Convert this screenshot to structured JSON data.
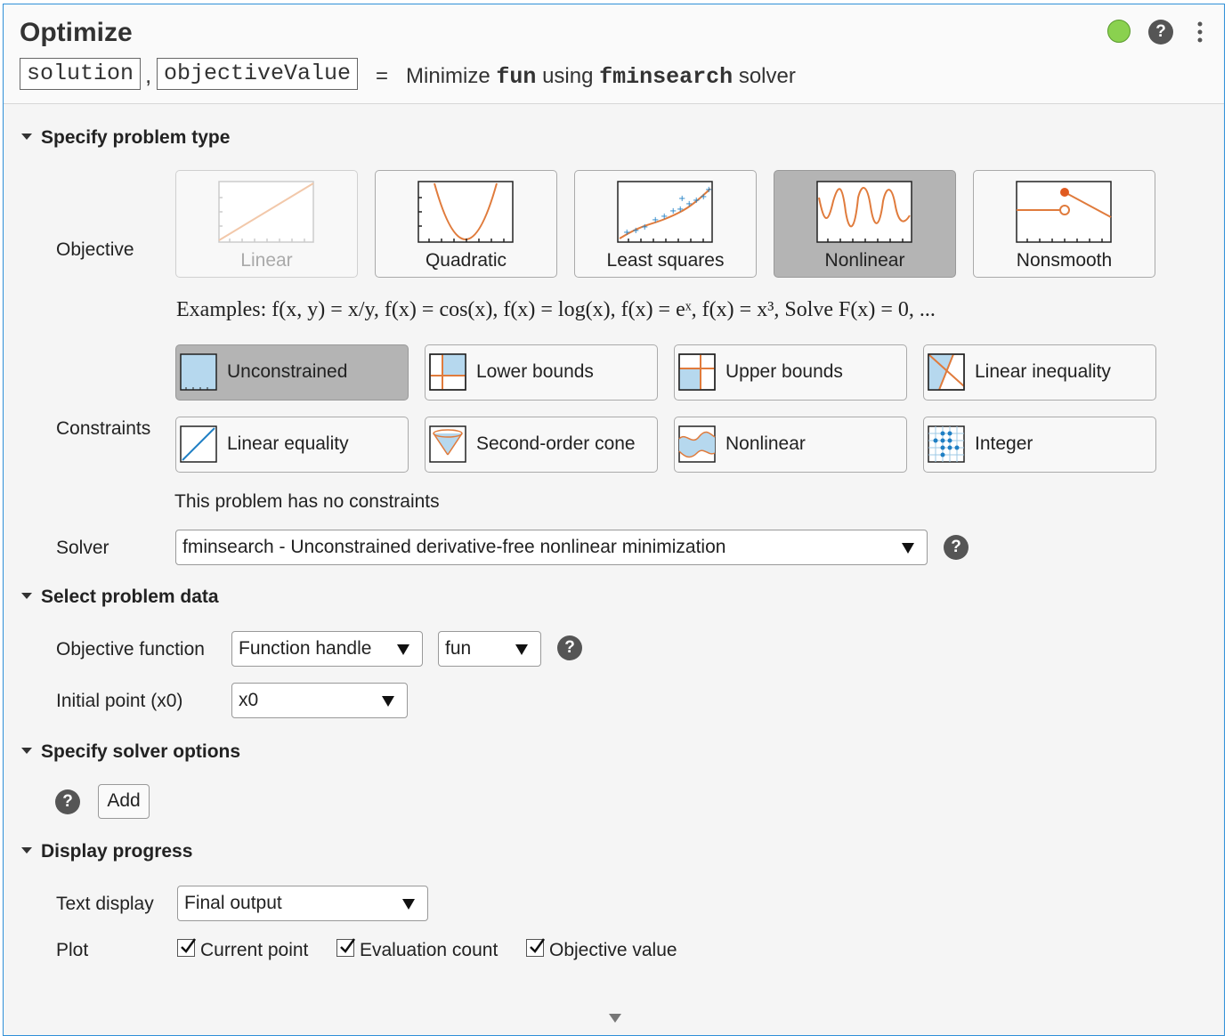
{
  "header": {
    "title": "Optimize",
    "outputs": [
      "solution",
      "objectiveValue"
    ],
    "comma": ",",
    "equals": "=",
    "minimize_text": "Minimize",
    "fun_name": "fun",
    "using_text": "using",
    "solver_name": "fminsearch",
    "solver_suffix": "solver",
    "status_color": "#8ad14f",
    "help_glyph": "?"
  },
  "problem_type": {
    "section_title": "Specify problem type",
    "objective_label": "Objective",
    "objectives": [
      {
        "label": "Linear",
        "icon": "linear-plot-icon",
        "state": "disabled"
      },
      {
        "label": "Quadratic",
        "icon": "quadratic-plot-icon",
        "state": "normal"
      },
      {
        "label": "Least squares",
        "icon": "least-squares-plot-icon",
        "state": "normal"
      },
      {
        "label": "Nonlinear",
        "icon": "nonlinear-plot-icon",
        "state": "selected"
      },
      {
        "label": "Nonsmooth",
        "icon": "nonsmooth-plot-icon",
        "state": "normal"
      }
    ],
    "examples_text": "Examples: f(x, y) = x/y, f(x) = cos(x), f(x) = log(x), f(x) = eˣ, f(x) = x³, Solve F(x) = 0, ...",
    "constraints_label": "Constraints",
    "constraints": [
      {
        "label": "Unconstrained",
        "icon": "unconstrained-icon",
        "state": "selected"
      },
      {
        "label": "Lower bounds",
        "icon": "lower-bounds-icon",
        "state": "normal"
      },
      {
        "label": "Upper bounds",
        "icon": "upper-bounds-icon",
        "state": "normal"
      },
      {
        "label": "Linear inequality",
        "icon": "linear-inequality-icon",
        "state": "normal"
      },
      {
        "label": "Linear equality",
        "icon": "linear-equality-icon",
        "state": "normal"
      },
      {
        "label": "Second-order cone",
        "icon": "second-order-cone-icon",
        "state": "normal"
      },
      {
        "label": "Nonlinear",
        "icon": "nonlinear-constraint-icon",
        "state": "normal"
      },
      {
        "label": "Integer",
        "icon": "integer-icon",
        "state": "normal"
      }
    ],
    "constraint_note": "This problem has no constraints",
    "solver_label": "Solver",
    "solver_value": "fminsearch - Unconstrained derivative-free nonlinear minimization"
  },
  "problem_data": {
    "section_title": "Select problem data",
    "objective_function_label": "Objective function",
    "objective_type_value": "Function handle",
    "objective_name_value": "fun",
    "initial_point_label": "Initial point (x0)",
    "initial_point_value": "x0"
  },
  "solver_options": {
    "section_title": "Specify solver options",
    "add_label": "Add"
  },
  "display_progress": {
    "section_title": "Display progress",
    "text_display_label": "Text display",
    "text_display_value": "Final output",
    "plot_label": "Plot",
    "plots": [
      {
        "label": "Current point",
        "checked": true
      },
      {
        "label": "Evaluation count",
        "checked": true
      },
      {
        "label": "Objective value",
        "checked": true
      }
    ]
  },
  "colors": {
    "accent_border": "#2f8fd8",
    "plot_line": "#e07b3c",
    "plot_marker": "#1f7fc4",
    "region_fill": "#b6d8ee",
    "selected_bg": "#b4b4b4"
  }
}
